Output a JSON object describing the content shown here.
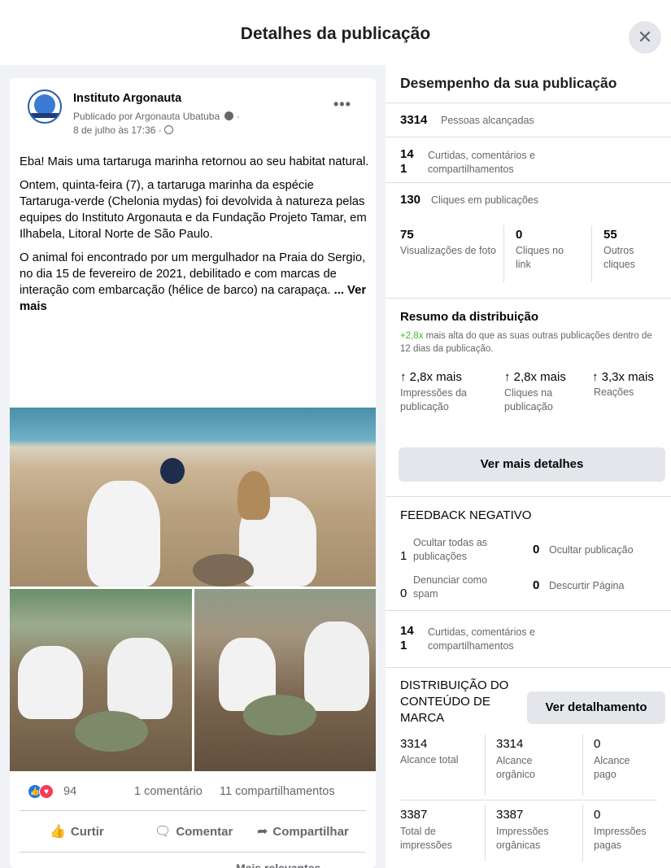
{
  "header": {
    "title": "Detalhes da publicação",
    "close_label": "✕"
  },
  "post": {
    "page_name": "Instituto Argonauta",
    "published_by": "Publicado por Argonauta Ubatuba",
    "date": "8 de julho às 17:36 ·",
    "paragraphs": [
      "Eba! Mais uma tartaruga marinha retornou ao seu habitat natural.",
      "Ontem, quinta-feira (7), a tartaruga marinha da espécie Tartaruga-verde (Chelonia mydas) foi devolvida à natureza pelas equipes do Instituto Argonauta e da Fundação Projeto Tamar, em Ilhabela, Litoral Norte de São Paulo.",
      "O animal foi encontrado por um mergulhador na Praia do Sergio, no dia 15 de fevereiro de 2021, debilitado e com marcas de interação com embarcação (hélice de barco) na carapaça."
    ],
    "see_more": "... Ver mais",
    "reactions_count": "94",
    "comments": "1 comentário",
    "shares": "11 compartilhamentos",
    "actions": {
      "like": "Curtir",
      "comment": "Comentar",
      "share": "Compartilhar"
    },
    "more_relevant": "Mais relevantes"
  },
  "panel": {
    "title": "Desempenho da sua publicação",
    "reach": {
      "value": "3314",
      "label": "Pessoas alcançadas"
    },
    "engagement": {
      "value_top": "14",
      "value_bottom": "1",
      "label": "Curtidas, comentários e compartilhamentos"
    },
    "clicks": {
      "value": "130",
      "label": "Cliques em publicações"
    },
    "click_breakdown": [
      {
        "value": "75",
        "label": "Visualizações de foto"
      },
      {
        "value": "0",
        "label": "Cliques no link"
      },
      {
        "value": "55",
        "label": "Outros cliques"
      }
    ],
    "distribution": {
      "title": "Resumo da distribuição",
      "highlight": "+2,8x",
      "desc": "mais alta do que as suas outras publicações dentro de 12 dias da publicação.",
      "metrics": [
        {
          "value": "↑ 2,8x mais",
          "label": "Impressões da publicação"
        },
        {
          "value": "↑ 2,8x mais",
          "label": "Cliques na publicação"
        },
        {
          "value": "↑ 3,3x mais",
          "label": "Reações"
        }
      ],
      "button": "Ver mais detalhes"
    },
    "negative_feedback": {
      "title": "FEEDBACK NEGATIVO",
      "items": [
        {
          "value": "1",
          "label": "Ocultar todas as publicações"
        },
        {
          "value": "0",
          "label": "Ocultar publicação"
        },
        {
          "value": "0",
          "label": "Denunciar como spam"
        },
        {
          "value": "0",
          "label": "Descurtir Página"
        }
      ]
    },
    "engagement2": {
      "value_top": "14",
      "value_bottom": "1",
      "label": "Curtidas, comentários e compartilhamentos"
    },
    "branded": {
      "title": "DISTRIBUIÇÃO DO CONTEÚDO DE MARCA",
      "button": "Ver detalhamento",
      "row1": [
        {
          "value": "3314",
          "label": "Alcance total"
        },
        {
          "value": "3314",
          "label": "Alcance orgânico"
        },
        {
          "value": "0",
          "label": "Alcance pago"
        }
      ],
      "row2": [
        {
          "value": "3387",
          "label": "Total de impressões"
        },
        {
          "value": "3387",
          "label": "Impressões orgânicas"
        },
        {
          "value": "0",
          "label": "Impressões pagas"
        }
      ]
    }
  }
}
